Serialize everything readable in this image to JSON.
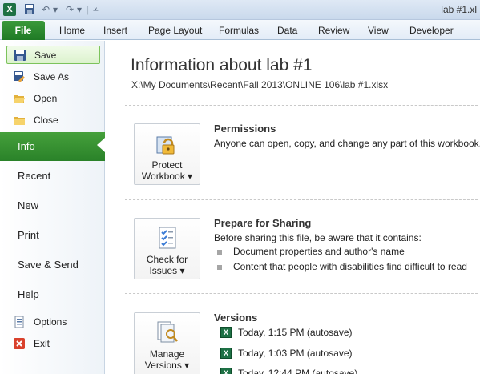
{
  "window": {
    "title": "lab #1.xl"
  },
  "quick_access": {
    "app_icon": "excel-icon",
    "items": [
      "save-icon",
      "undo-icon",
      "redo-icon",
      "customize-icon"
    ]
  },
  "ribbon": {
    "file_tab": "File",
    "tabs": [
      "Home",
      "Insert",
      "Page Layout",
      "Formulas",
      "Data",
      "Review",
      "View",
      "Developer"
    ]
  },
  "backstage_nav": {
    "commands_top": [
      {
        "label": "Save",
        "icon": "save-icon",
        "selected": true
      },
      {
        "label": "Save As",
        "icon": "save-as-icon"
      },
      {
        "label": "Open",
        "icon": "open-folder-icon"
      },
      {
        "label": "Close",
        "icon": "close-folder-icon"
      }
    ],
    "tabs": [
      "Info",
      "Recent",
      "New",
      "Print",
      "Save & Send",
      "Help"
    ],
    "active_tab": "Info",
    "commands_bottom": [
      {
        "label": "Options",
        "icon": "options-icon"
      },
      {
        "label": "Exit",
        "icon": "exit-icon"
      }
    ]
  },
  "info": {
    "heading": "Information about lab #1",
    "path": "X:\\My Documents\\Recent\\Fall 2013\\ONLINE 106\\lab #1.xlsx",
    "permissions": {
      "button_line1": "Protect",
      "button_line2": "Workbook ▾",
      "icon": "lock-icon",
      "title": "Permissions",
      "text": "Anyone can open, copy, and change any part of this workbook."
    },
    "prepare": {
      "button_line1": "Check for",
      "button_line2": "Issues ▾",
      "icon": "checklist-icon",
      "title": "Prepare for Sharing",
      "text": "Before sharing this file, be aware that it contains:",
      "bullets": [
        "Document properties and author's name",
        "Content that people with disabilities find difficult to read"
      ]
    },
    "versions": {
      "button_line1": "Manage",
      "button_line2": "Versions ▾",
      "icon": "manage-versions-icon",
      "title": "Versions",
      "items": [
        "Today, 1:15 PM (autosave)",
        "Today, 1:03 PM (autosave)",
        "Today, 12:44 PM (autosave)"
      ]
    }
  },
  "colors": {
    "file_green": "#2a8229",
    "accent_blue": "#1e4e8c"
  }
}
